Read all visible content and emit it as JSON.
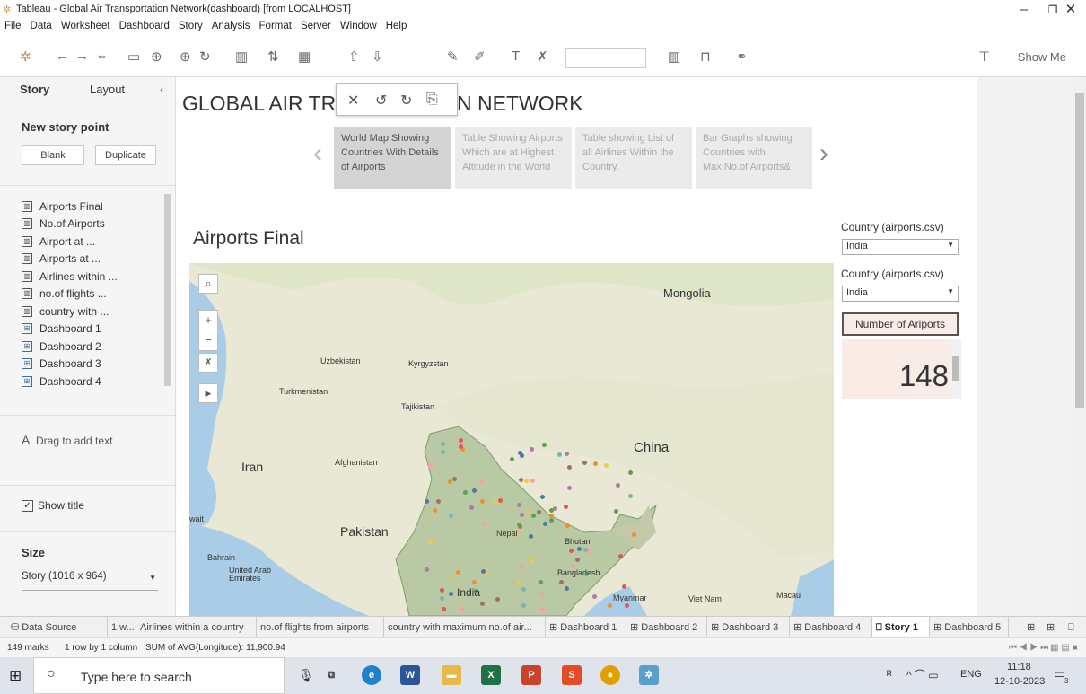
{
  "window": {
    "title": "Tableau - Global Air Transportation Network(dashboard) [from LOCALHOST]"
  },
  "menu": [
    "File",
    "Data",
    "Worksheet",
    "Dashboard",
    "Story",
    "Analysis",
    "Format",
    "Server",
    "Window",
    "Help"
  ],
  "toolbar": {
    "show_me": "Show Me"
  },
  "leftpane": {
    "tabs": [
      "Story",
      "Layout"
    ],
    "new_story_point": "New story point",
    "blank": "Blank",
    "duplicate": "Duplicate",
    "sheets": [
      {
        "label": "Airports Final",
        "type": "sheet"
      },
      {
        "label": "No.of Airports",
        "type": "sheet"
      },
      {
        "label": "Airport at ...",
        "type": "sheet"
      },
      {
        "label": "Airports at ...",
        "type": "sheet"
      },
      {
        "label": "Airlines within ...",
        "type": "sheet"
      },
      {
        "label": "no.of flights ...",
        "type": "sheet"
      },
      {
        "label": "country with ...",
        "type": "sheet"
      },
      {
        "label": "Dashboard 1",
        "type": "dashboard"
      },
      {
        "label": "Dashboard 2",
        "type": "dashboard"
      },
      {
        "label": "Dashboard 3",
        "type": "dashboard"
      },
      {
        "label": "Dashboard 4",
        "type": "dashboard"
      }
    ],
    "drag_text": "Drag to add text",
    "show_title": "Show title",
    "size_label": "Size",
    "size_value": "Story (1016 x 964)"
  },
  "story": {
    "title_left": "GLOBAL AIR TRAN",
    "title_right": "N NETWORK",
    "points": [
      "World Map Showing Countries With Details of Airports",
      "Table Showing Airports Which are at Highest Altitude in the World",
      "Table showing List of all Airlines Within the Country.",
      "Bar Graphs showing Countries with Max.No.of Airports&"
    ]
  },
  "sheet": {
    "title": "Airports Final"
  },
  "filters": [
    {
      "label": "Country (airports.csv)",
      "value": "India"
    },
    {
      "label": "Country (airports.csv)",
      "value": "India"
    }
  ],
  "kpi": {
    "label": "Number of Ariports",
    "value": "148"
  },
  "map": {
    "labels": {
      "mongolia": "Mongolia",
      "uzbekistan": "Uzbekistan",
      "kyrgyzstan": "Kyrgyzstan",
      "turkmenistan": "Turkmenistan",
      "tajikistan": "Tajikistan",
      "china": "China",
      "afghanistan": "Afghanistan",
      "iran": "Iran",
      "pakistan": "Pakistan",
      "nepal": "Nepal",
      "bhutan": "Bhutan",
      "bangladesh": "Bangladesh",
      "india": "India",
      "myanmar": "Myanmar",
      "vietnam": "Viet Nam",
      "macau": "Macau",
      "bahrain": "Bahrain",
      "uae": "United Arab\nEmirates",
      "kuwait": "wait"
    }
  },
  "sheettabs": [
    "Data Source",
    "1 w...",
    "Airlines within a country",
    "no.of flights from airports",
    "country  with maximum no.of air...",
    "Dashboard 1",
    "Dashboard 2",
    "Dashboard 3",
    "Dashboard 4",
    "Story 1",
    "Dashboard 5"
  ],
  "status": {
    "marks": "149 marks",
    "rows": "1 row by 1 column",
    "sum": "SUM of AVG(Longitude): 11,900.94"
  },
  "taskbar": {
    "search": "Type here to search",
    "lang": "ENG",
    "time": "11:18",
    "date": "12-10-2023",
    "notif": "3"
  }
}
